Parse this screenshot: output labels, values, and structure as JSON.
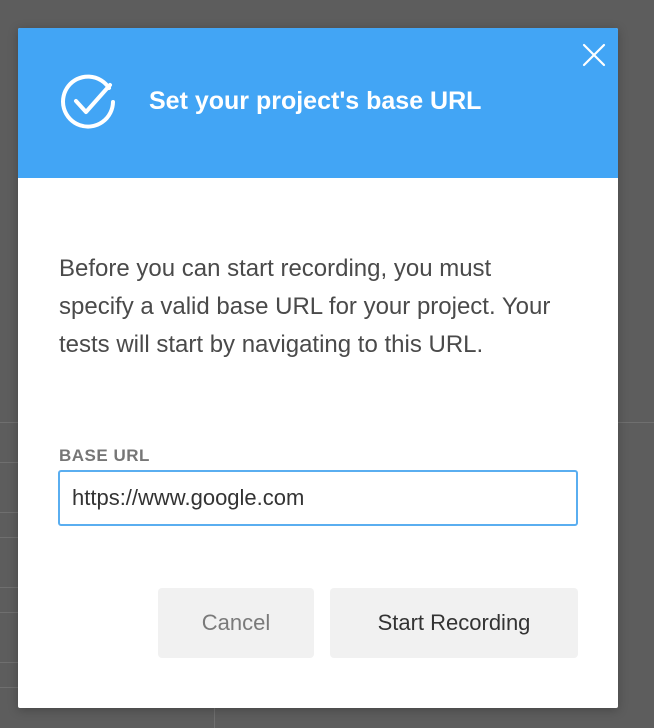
{
  "colors": {
    "header_bg": "#42a5f5",
    "overlay_bg": "#5d5d5d",
    "input_border": "#5aaef0",
    "button_bg": "#f1f1f1"
  },
  "dialog": {
    "icon": "check-circle-icon",
    "title": "Set your project's base URL",
    "close_icon": "close-icon",
    "description": "Before you can start recording, you must specify a valid base URL for your project. Your tests will start by navigating to this URL.",
    "field": {
      "label": "BASE URL",
      "value": "https://www.google.com"
    },
    "buttons": {
      "cancel": "Cancel",
      "start": "Start Recording"
    }
  }
}
